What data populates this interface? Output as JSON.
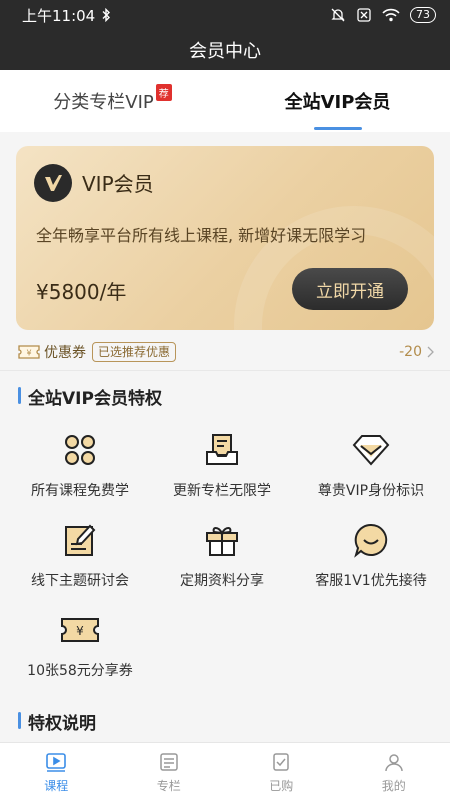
{
  "status_bar": {
    "time": "上午11:04",
    "battery": "73"
  },
  "title_bar": {
    "title": "会员中心"
  },
  "tabs": [
    {
      "label": "分类专栏VIP",
      "badge": "荐",
      "active": false
    },
    {
      "label": "全站VIP会员",
      "active": true
    }
  ],
  "vip_card": {
    "title": "VIP会员",
    "description": "全年畅享平台所有线上课程, 新增好课无限学习",
    "price": "¥5800/年",
    "button_label": "立即开通"
  },
  "coupon": {
    "label": "优惠券",
    "tag": "已选推荐优惠",
    "amount": "-20"
  },
  "privileges_section": {
    "title": "全站VIP会员特权",
    "items": [
      {
        "label": "所有课程免费学",
        "icon": "clover-icon"
      },
      {
        "label": "更新专栏无限学",
        "icon": "document-tray-icon"
      },
      {
        "label": "尊贵VIP身份标识",
        "icon": "diamond-icon"
      },
      {
        "label": "线下主题研讨会",
        "icon": "edit-note-icon"
      },
      {
        "label": "定期资料分享",
        "icon": "gift-icon"
      },
      {
        "label": "客服1V1优先接待",
        "icon": "chat-smile-icon"
      },
      {
        "label": "10张58元分享券",
        "icon": "yen-ticket-icon"
      }
    ]
  },
  "explain_section": {
    "title": "特权说明"
  },
  "bottom_nav": [
    {
      "label": "课程",
      "icon": "play-video-icon",
      "active": true
    },
    {
      "label": "专栏",
      "icon": "list-doc-icon",
      "active": false
    },
    {
      "label": "已购",
      "icon": "purchased-check-icon",
      "active": false
    },
    {
      "label": "我的",
      "icon": "user-icon",
      "active": false
    }
  ],
  "colors": {
    "accent_blue": "#4a90e2",
    "gold_text": "#b28c4b",
    "icon_gold": "#f3d9a4",
    "dark_bar": "#2b2b2b"
  }
}
